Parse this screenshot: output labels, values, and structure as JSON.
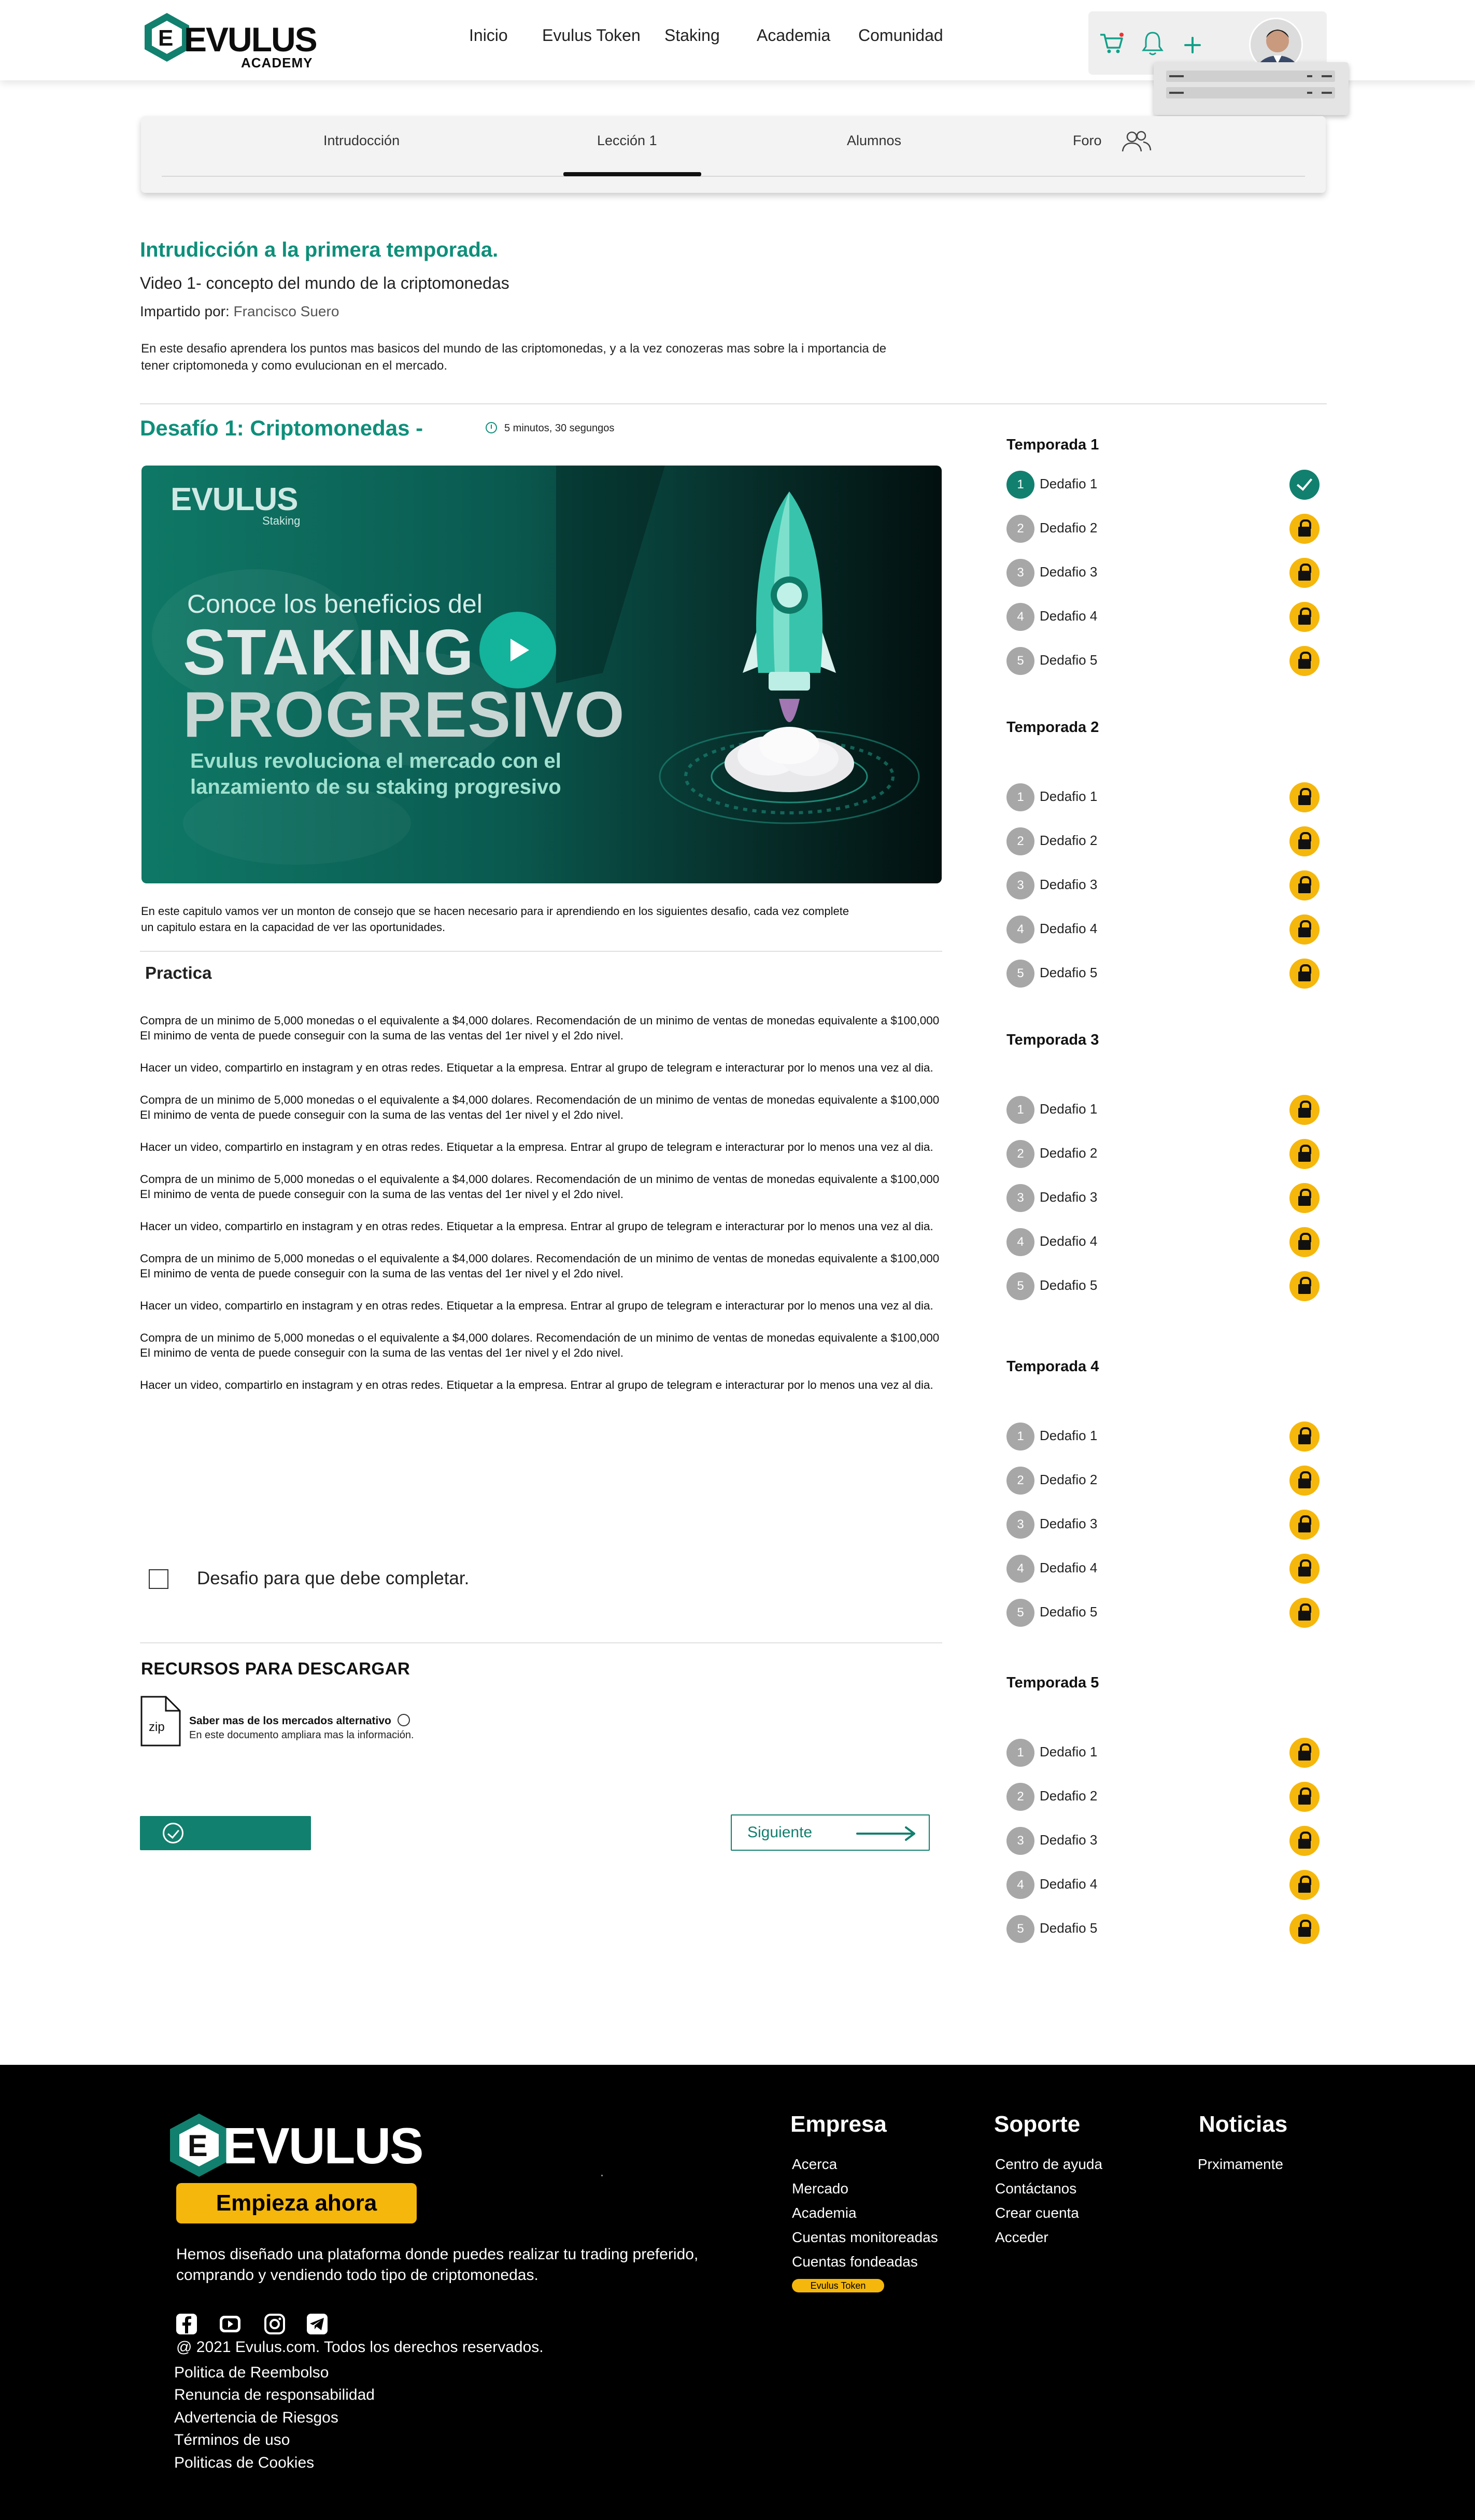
{
  "nav": {
    "brand": "EVULUS",
    "brand_sub": "ACADEMY",
    "menu": [
      "Inicio",
      "Evulus Token",
      "Staking",
      "Academia",
      "Comunidad"
    ]
  },
  "icons": {
    "cart": "cart-icon",
    "bell": "bell-icon",
    "plus": "plus-icon",
    "users": "users-icon",
    "clock": "clock-icon",
    "zip": "zip-file-icon",
    "social": [
      "facebook-icon",
      "youtube-icon",
      "instagram-icon",
      "telegram-icon"
    ]
  },
  "tabs": [
    "Intrudocción",
    "Lección 1",
    "Alumnos",
    "Foro"
  ],
  "intro": {
    "title": "Intrudicción a la primera temporada.",
    "subtitle": "Video 1- concepto del mundo de la criptomonedas",
    "taught_by_label": "Impartido por:",
    "teacher": "Francisco Suero",
    "description": "En este desafio aprendera los puntos mas basicos del mundo de las criptomonedas, y a la vez conozeras mas sobre la i mportancia de tener criptomoneda y como evulucionan en el mercado."
  },
  "challenge": {
    "title": "Desafío 1: Criptomonedas -",
    "duration": "5 minutos, 30 segungos",
    "video": {
      "brand": "EVULUS",
      "brand_sub": "Staking",
      "line1": "Conoce los beneficios del",
      "big1": "STAKING",
      "big2": "PROGRESIVO",
      "line3": "Evulus revoluciona el mercado con el lanzamiento de su staking progresivo"
    },
    "video_description": "En este capitulo vamos ver un monton de consejo que se hacen necesario para ir aprendiendo en los siguientes desafio, cada vez complete un capitulo estara en la capacidad de ver las oportunidades.",
    "practice_title": "Practica",
    "practice_paragraphs": [
      "Compra de un minimo de 5,000 monedas o el equivalente a $4,000 dolares. Recomendación de un minimo de ventas de monedas equivalente a $100,000 El minimo de venta de puede conseguir con la suma de las ventas del 1er nivel y el 2do nivel.",
      "Hacer un video, compartirlo en instagram y en otras redes. Etiquetar a la empresa. Entrar al grupo de telegram e interacturar por lo menos una vez al dia.",
      "Compra de un minimo de 5,000 monedas o el equivalente a $4,000 dolares. Recomendación de un minimo de ventas de monedas equivalente a $100,000 El minimo de venta de puede conseguir con la suma de las ventas del 1er nivel y el 2do nivel.",
      "Hacer un video, compartirlo en instagram y en otras redes. Etiquetar a la empresa. Entrar al grupo de telegram e interacturar por lo menos una vez al dia.",
      "Compra de un minimo de 5,000 monedas o el equivalente a $4,000 dolares. Recomendación de un minimo de ventas de monedas equivalente a $100,000 El minimo de venta de puede conseguir con la suma de las ventas del 1er nivel y el 2do nivel.",
      "Hacer un video, compartirlo en instagram y en otras redes. Etiquetar a la empresa. Entrar al grupo de telegram e interacturar por lo menos una vez al dia.",
      "Compra de un minimo de 5,000 monedas o el equivalente a $4,000 dolares. Recomendación de un minimo de ventas de monedas equivalente a $100,000 El minimo de venta de puede conseguir con la suma de las ventas del 1er nivel y el 2do nivel.",
      "Hacer un video, compartirlo en instagram y en otras redes. Etiquetar a la empresa. Entrar al grupo de telegram e interacturar por lo menos una vez al dia.",
      "Compra de un minimo de 5,000 monedas o el equivalente a $4,000 dolares. Recomendación de un minimo de ventas de monedas equivalente a $100,000 El minimo de venta de puede conseguir con la suma de las ventas del 1er nivel y el 2do nivel.",
      "Hacer un video, compartirlo en instagram y en otras redes. Etiquetar a la empresa. Entrar al grupo de telegram e interacturar por lo menos una vez al dia."
    ],
    "checkbox_label": "Desafio para que debe completar.",
    "checkbox_checked": false,
    "resources_title": "RECURSOS PARA DESCARGAR",
    "resource": {
      "file_type": "zip",
      "name": "Saber mas de los mercados alternativo",
      "description": "En este documento ampliara mas la información."
    },
    "next_label": "Siguiente"
  },
  "seasons": [
    {
      "title": "Temporada 1",
      "chapters": [
        {
          "num": "1",
          "label": "Dedafio 1",
          "status": "done"
        },
        {
          "num": "2",
          "label": "Dedafio 2",
          "status": "locked"
        },
        {
          "num": "3",
          "label": "Dedafio 3",
          "status": "locked"
        },
        {
          "num": "4",
          "label": "Dedafio 4",
          "status": "locked"
        },
        {
          "num": "5",
          "label": "Dedafio 5",
          "status": "locked"
        }
      ]
    },
    {
      "title": "Temporada 2",
      "chapters": [
        {
          "num": "1",
          "label": "Dedafio 1",
          "status": "locked"
        },
        {
          "num": "2",
          "label": "Dedafio 2",
          "status": "locked"
        },
        {
          "num": "3",
          "label": "Dedafio 3",
          "status": "locked"
        },
        {
          "num": "4",
          "label": "Dedafio 4",
          "status": "locked"
        },
        {
          "num": "5",
          "label": "Dedafio 5",
          "status": "locked"
        }
      ]
    },
    {
      "title": "Temporada 3",
      "chapters": [
        {
          "num": "1",
          "label": "Dedafio 1",
          "status": "locked"
        },
        {
          "num": "2",
          "label": "Dedafio 2",
          "status": "locked"
        },
        {
          "num": "3",
          "label": "Dedafio 3",
          "status": "locked"
        },
        {
          "num": "4",
          "label": "Dedafio 4",
          "status": "locked"
        },
        {
          "num": "5",
          "label": "Dedafio 5",
          "status": "locked"
        }
      ]
    },
    {
      "title": "Temporada 4",
      "chapters": [
        {
          "num": "1",
          "label": "Dedafio 1",
          "status": "locked"
        },
        {
          "num": "2",
          "label": "Dedafio 2",
          "status": "locked"
        },
        {
          "num": "3",
          "label": "Dedafio 3",
          "status": "locked"
        },
        {
          "num": "4",
          "label": "Dedafio 4",
          "status": "locked"
        },
        {
          "num": "5",
          "label": "Dedafio 5",
          "status": "locked"
        }
      ]
    },
    {
      "title": "Temporada 5",
      "chapters": [
        {
          "num": "1",
          "label": "Dedafio 1",
          "status": "locked"
        },
        {
          "num": "2",
          "label": "Dedafio 2",
          "status": "locked"
        },
        {
          "num": "3",
          "label": "Dedafio 3",
          "status": "locked"
        },
        {
          "num": "4",
          "label": "Dedafio 4",
          "status": "locked"
        },
        {
          "num": "5",
          "label": "Dedafio 5",
          "status": "locked"
        }
      ]
    }
  ],
  "footer": {
    "brand": "EVULUS",
    "cta": "Empieza ahora",
    "description": "Hemos diseñado una plataforma donde puedes realizar tu trading preferido, comprando y vendiendo todo tipo de criptomonedas.",
    "copyright": "@ 2021 Evulus.com. Todos los derechos reservados.",
    "legal": [
      "Politica de Reembolso",
      "Renuncia de responsabilidad",
      "Advertencia de Riesgos",
      "Términos de uso",
      "Politicas de Cookies"
    ],
    "columns": [
      {
        "title": "Empresa",
        "links": [
          "Acerca",
          "Mercado",
          "Academia",
          "Cuentas monitoreadas",
          "Cuentas fondeadas"
        ]
      },
      {
        "title": "Soporte",
        "links": [
          "Centro de ayuda",
          "Contáctanos",
          "Crear cuenta",
          "Acceder"
        ]
      },
      {
        "title": "Noticias",
        "links": [
          "Prximamente"
        ]
      }
    ],
    "badge": "Evulus Token"
  },
  "colors": {
    "accent": "#12806e",
    "accent_text": "#0e8f7a",
    "lock": "#f5b70b",
    "footer_bg": "#000000"
  }
}
